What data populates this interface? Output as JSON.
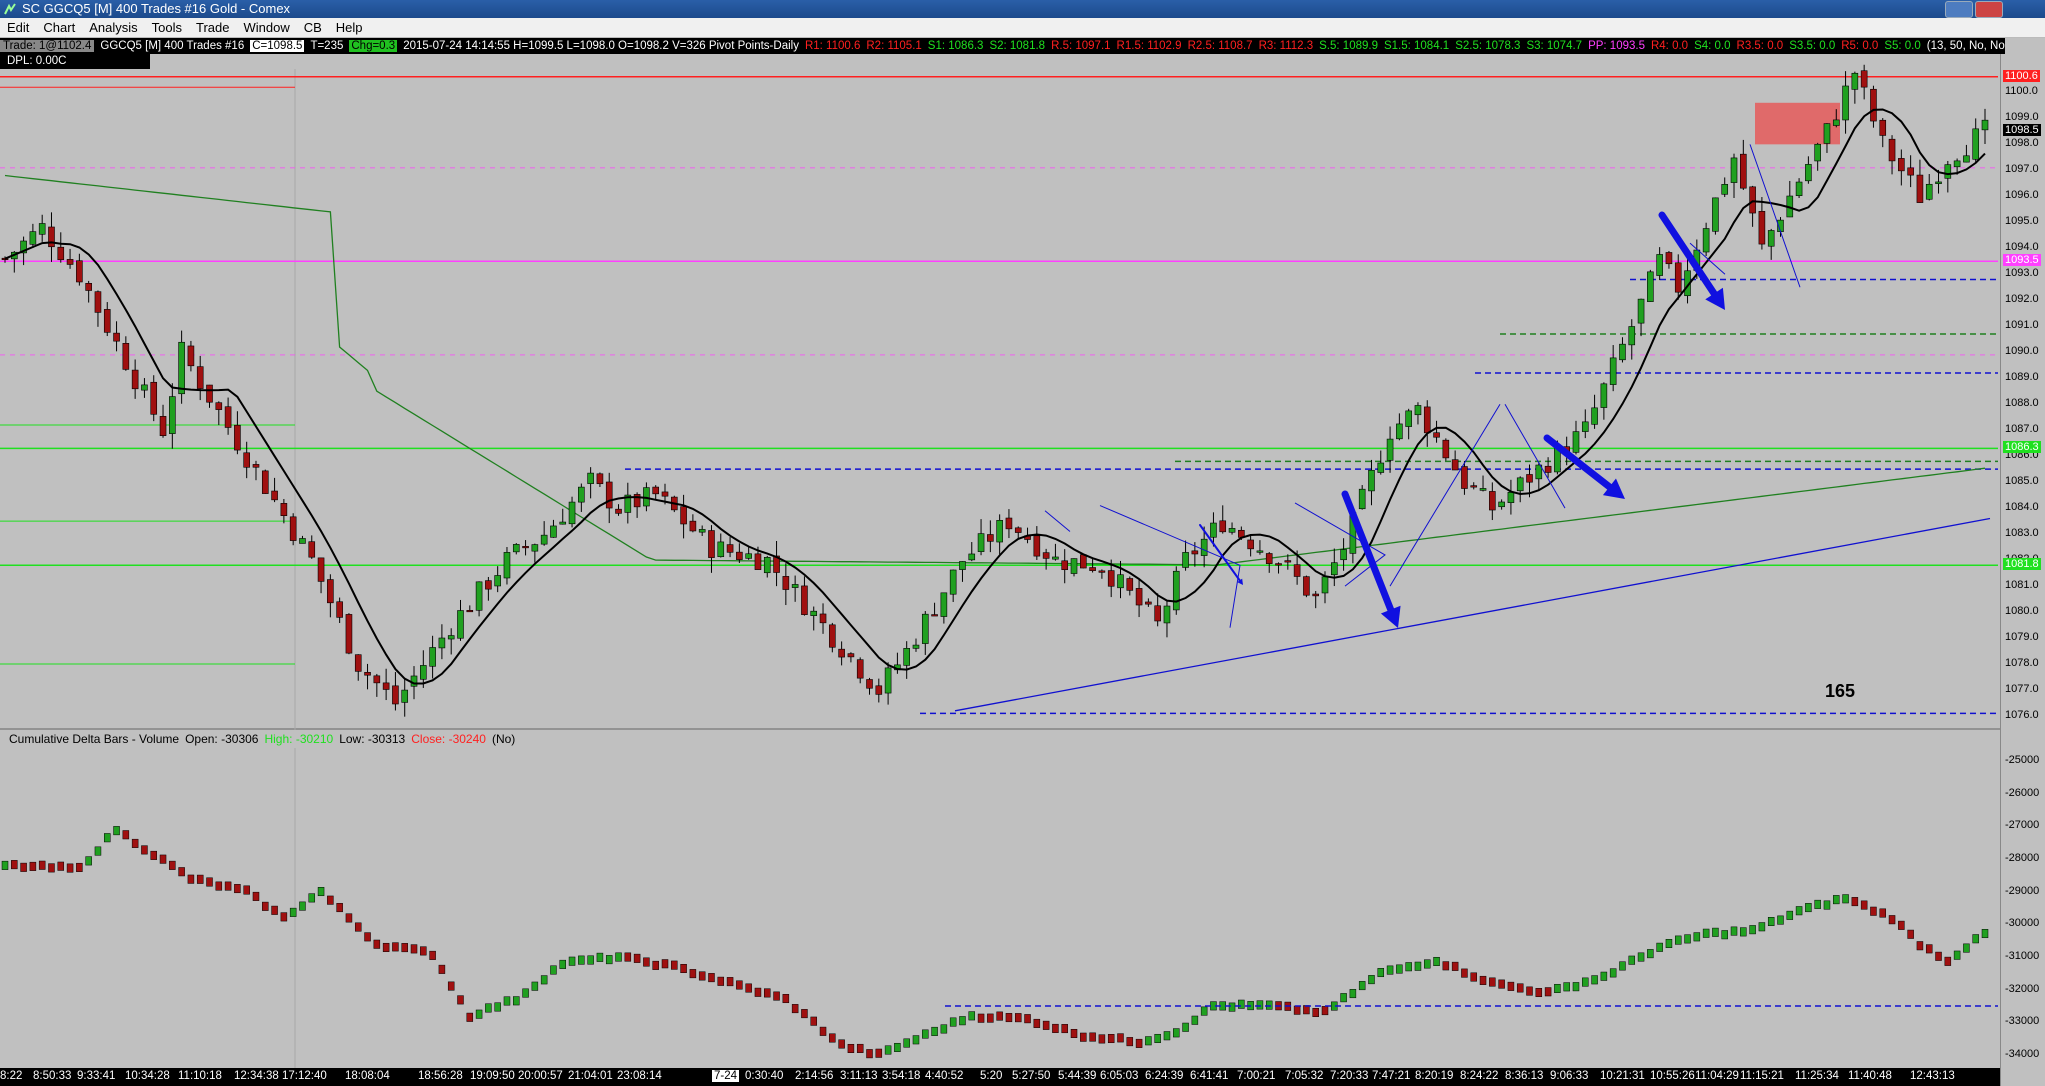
{
  "window": {
    "title": "SC GGCQ5 [M]  400 Trades  #16  Gold - Comex"
  },
  "menu": [
    "Edit",
    "Chart",
    "Analysis",
    "Tools",
    "Trade",
    "Window",
    "CB",
    "Help"
  ],
  "info": {
    "trade": "Trade: 1@1102.4",
    "symbol": "GGCQ5 [M]  400 Trades  #16",
    "last": "C=1098.5",
    "tick": "T=235",
    "chg": "Chg=0.3",
    "ohlc": "2015-07-24 14:14:55 H=1099.5 L=1098.0 O=1098.2 V=326 Pivot Points-Daily",
    "pivots": [
      {
        "t": "R1: 1100.6",
        "c": "#ff2020"
      },
      {
        "t": "R2: 1105.1",
        "c": "#ff2020"
      },
      {
        "t": "S1: 1086.3",
        "c": "#20e020"
      },
      {
        "t": "S2: 1081.8",
        "c": "#20e020"
      },
      {
        "t": "R.5: 1097.1",
        "c": "#ff2020"
      },
      {
        "t": "R1.5: 1102.9",
        "c": "#ff2020"
      },
      {
        "t": "R2.5: 1108.7",
        "c": "#ff2020"
      },
      {
        "t": "R3: 1112.3",
        "c": "#ff2020"
      },
      {
        "t": "S.5: 1089.9",
        "c": "#20e020"
      },
      {
        "t": "S1.5: 1084.1",
        "c": "#20e020"
      },
      {
        "t": "S2.5: 1078.3",
        "c": "#20e020"
      },
      {
        "t": "S3: 1074.7",
        "c": "#20e020"
      },
      {
        "t": "PP: 1093.5",
        "c": "#ff40ff"
      },
      {
        "t": "R4: 0.0",
        "c": "#ff2020"
      },
      {
        "t": "S4: 0.0",
        "c": "#20e020"
      },
      {
        "t": "R3.5: 0.0",
        "c": "#ff2020"
      },
      {
        "t": "S3.5: 0.0",
        "c": "#20e020"
      },
      {
        "t": "R5: 0.0",
        "c": "#ff2020"
      },
      {
        "t": "S5: 0.0",
        "c": "#20e020"
      },
      {
        "t": "(13, 50, No, No, #1, No, No, No,",
        "c": "#ffffff"
      }
    ],
    "dpl": "DPL: 0.00C"
  },
  "pane2": {
    "name": "Cumulative Delta Bars - Volume",
    "open": "Open: -30306",
    "high": "High: -30210",
    "low": "Low: -30313",
    "close": "Close: -30240",
    "extra": "(No)"
  },
  "annotation": "165",
  "price_axis": [
    "1100.0",
    "1099.0",
    "1098.0",
    "1097.0",
    "1096.0",
    "1095.0",
    "1094.0",
    "1093.0",
    "1092.0",
    "1091.0",
    "1090.0",
    "1089.0",
    "1088.0",
    "1087.0",
    "1086.0",
    "1085.0",
    "1084.0",
    "1083.0",
    "1082.0",
    "1081.0",
    "1080.0",
    "1079.0",
    "1078.0",
    "1077.0",
    "1076.0"
  ],
  "price_tags": [
    {
      "t": "1100.6",
      "bg": "#ff2020",
      "fg": "#ffffff",
      "v": 1100.6
    },
    {
      "t": "1098.5",
      "bg": "#000000",
      "fg": "#ffffff",
      "v": 1098.5
    },
    {
      "t": "1093.5",
      "bg": "#ff40ff",
      "fg": "#ffffff",
      "v": 1093.5
    },
    {
      "t": "1086.3",
      "bg": "#20e020",
      "fg": "#ffffff",
      "v": 1086.3
    },
    {
      "t": "1081.8",
      "bg": "#20e020",
      "fg": "#ffffff",
      "v": 1081.8
    }
  ],
  "delta_axis": [
    "-25000",
    "-26000",
    "-27000",
    "-28000",
    "-29000",
    "-30000",
    "-31000",
    "-32000",
    "-33000",
    "-34000"
  ],
  "time_axis": [
    "8:22",
    "8:50:33",
    "9:33:41",
    "10:34:28",
    "11:10:18",
    "12:34:38",
    "17:12:40",
    "18:08:04",
    "18:56:28",
    "19:09:50",
    "20:00:57",
    "21:04:01",
    "23:08:14",
    "7-24",
    "0:30:40",
    "2:14:56",
    "3:11:13",
    "3:54:18",
    "4:40:52",
    "5:20",
    "5:27:50",
    "5:44:39",
    "6:05:03",
    "6:24:39",
    "6:41:41",
    "7:00:21",
    "7:05:32",
    "7:20:33",
    "7:47:21",
    "8:20:19",
    "8:24:22",
    "8:36:13",
    "9:06:33",
    "10:21:31",
    "10:55:26",
    "11:04:29",
    "11:15:21",
    "11:25:34",
    "11:40:48",
    "12:43:13"
  ],
  "colors": {
    "up": "#20a020",
    "down": "#a01010",
    "ma": "#000000",
    "ma_long": "#208020",
    "pivot_pp": "#ff40ff",
    "resistance": "#ff2020",
    "support": "#20e020",
    "blue_level": "#1010d0",
    "arrow": "#1010e0"
  },
  "chart_data": [
    {
      "type": "candlestick",
      "title": "GGCQ5 [M] 400 Trades #16 Gold - Comex",
      "ylim": [
        1075.5,
        1100.9
      ],
      "y_anchor_points": [
        {
          "t": 0,
          "price": 1093.6
        },
        {
          "t": 4,
          "price": 1094.8
        },
        {
          "t": 8,
          "price": 1093.0
        },
        {
          "t": 14,
          "price": 1089.0
        },
        {
          "t": 17,
          "price": 1087.0
        },
        {
          "t": 19,
          "price": 1090.0
        },
        {
          "t": 26,
          "price": 1086.0
        },
        {
          "t": 33,
          "price": 1082.0
        },
        {
          "t": 38,
          "price": 1078.0
        },
        {
          "t": 42,
          "price": 1076.5
        },
        {
          "t": 48,
          "price": 1079.5
        },
        {
          "t": 54,
          "price": 1082.0
        },
        {
          "t": 58,
          "price": 1083.0
        },
        {
          "t": 63,
          "price": 1085.0
        },
        {
          "t": 66,
          "price": 1084.0
        },
        {
          "t": 70,
          "price": 1084.5
        },
        {
          "t": 76,
          "price": 1082.5
        },
        {
          "t": 82,
          "price": 1082.0
        },
        {
          "t": 88,
          "price": 1079.5
        },
        {
          "t": 94,
          "price": 1077.0
        },
        {
          "t": 97,
          "price": 1078.5
        },
        {
          "t": 103,
          "price": 1082.0
        },
        {
          "t": 108,
          "price": 1083.5
        },
        {
          "t": 113,
          "price": 1082.0
        },
        {
          "t": 118,
          "price": 1081.8
        },
        {
          "t": 124,
          "price": 1079.5
        },
        {
          "t": 127,
          "price": 1082.0
        },
        {
          "t": 131,
          "price": 1083.5
        },
        {
          "t": 137,
          "price": 1082.0
        },
        {
          "t": 141,
          "price": 1080.5
        },
        {
          "t": 144,
          "price": 1082.5
        },
        {
          "t": 149,
          "price": 1087.0
        },
        {
          "t": 152,
          "price": 1087.8
        },
        {
          "t": 157,
          "price": 1085.0
        },
        {
          "t": 160,
          "price": 1084.0
        },
        {
          "t": 165,
          "price": 1085.5
        },
        {
          "t": 170,
          "price": 1087.0
        },
        {
          "t": 175,
          "price": 1091.0
        },
        {
          "t": 178,
          "price": 1093.5
        },
        {
          "t": 180,
          "price": 1092.5
        },
        {
          "t": 183,
          "price": 1095.0
        },
        {
          "t": 186,
          "price": 1097.5
        },
        {
          "t": 189,
          "price": 1094.0
        },
        {
          "t": 192,
          "price": 1096.0
        },
        {
          "t": 196,
          "price": 1098.5
        },
        {
          "t": 199,
          "price": 1100.8
        },
        {
          "t": 202,
          "price": 1098.0
        },
        {
          "t": 206,
          "price": 1096.0
        },
        {
          "t": 209,
          "price": 1097.5
        },
        {
          "t": 213,
          "price": 1098.5
        }
      ],
      "levels": [
        {
          "name": "R1",
          "price": 1100.6,
          "color": "#ff2020",
          "style": "solid"
        },
        {
          "name": "PP",
          "price": 1093.5,
          "color": "#ff40ff",
          "style": "solid"
        },
        {
          "name": "R.5",
          "price": 1097.1,
          "color": "#ff40ff",
          "style": "dashed-faint"
        },
        {
          "name": "S.5",
          "price": 1089.9,
          "color": "#ff40ff",
          "style": "dashed-faint"
        },
        {
          "name": "S1",
          "price": 1086.3,
          "color": "#20e020",
          "style": "solid"
        },
        {
          "name": "S2",
          "price": 1081.8,
          "color": "#20e020",
          "style": "solid"
        },
        {
          "name": "blue1",
          "price": 1092.8,
          "color": "#1010d0",
          "style": "dashed"
        },
        {
          "name": "green1",
          "price": 1090.7,
          "color": "#208020",
          "style": "dashed"
        },
        {
          "name": "blue2",
          "price": 1089.2,
          "color": "#1010d0",
          "style": "dashed"
        },
        {
          "name": "green2",
          "price": 1085.8,
          "color": "#208020",
          "style": "dashed"
        },
        {
          "name": "blue3",
          "price": 1085.5,
          "color": "#1010d0",
          "style": "dashed"
        },
        {
          "name": "blue4",
          "price": 1076.1,
          "color": "#1010d0",
          "style": "dashed"
        }
      ],
      "supply_zone": {
        "price_low": 1098.0,
        "price_high": 1099.6
      }
    },
    {
      "type": "bar",
      "title": "Cumulative Delta Bars - Volume",
      "ylim": [
        -34400,
        -24600
      ],
      "anchor_points": [
        {
          "t": 0,
          "v": -28200
        },
        {
          "t": 8,
          "v": -28300
        },
        {
          "t": 12,
          "v": -27100
        },
        {
          "t": 20,
          "v": -28600
        },
        {
          "t": 26,
          "v": -29000
        },
        {
          "t": 30,
          "v": -29800
        },
        {
          "t": 34,
          "v": -29000
        },
        {
          "t": 40,
          "v": -30600
        },
        {
          "t": 46,
          "v": -30900
        },
        {
          "t": 50,
          "v": -32800
        },
        {
          "t": 55,
          "v": -32300
        },
        {
          "t": 60,
          "v": -31200
        },
        {
          "t": 66,
          "v": -31000
        },
        {
          "t": 72,
          "v": -31300
        },
        {
          "t": 78,
          "v": -31800
        },
        {
          "t": 84,
          "v": -32300
        },
        {
          "t": 90,
          "v": -33700
        },
        {
          "t": 94,
          "v": -34000
        },
        {
          "t": 104,
          "v": -32800
        },
        {
          "t": 110,
          "v": -32900
        },
        {
          "t": 116,
          "v": -33400
        },
        {
          "t": 122,
          "v": -33600
        },
        {
          "t": 126,
          "v": -33300
        },
        {
          "t": 130,
          "v": -32500
        },
        {
          "t": 136,
          "v": -32500
        },
        {
          "t": 142,
          "v": -32700
        },
        {
          "t": 148,
          "v": -31500
        },
        {
          "t": 154,
          "v": -31100
        },
        {
          "t": 160,
          "v": -31800
        },
        {
          "t": 166,
          "v": -32100
        },
        {
          "t": 172,
          "v": -31600
        },
        {
          "t": 178,
          "v": -30700
        },
        {
          "t": 183,
          "v": -30300
        },
        {
          "t": 188,
          "v": -30200
        },
        {
          "t": 193,
          "v": -29600
        },
        {
          "t": 198,
          "v": -29200
        },
        {
          "t": 203,
          "v": -29800
        },
        {
          "t": 206,
          "v": -30600
        },
        {
          "t": 209,
          "v": -31100
        },
        {
          "t": 213,
          "v": -30300
        }
      ],
      "levels": [
        {
          "name": "blue",
          "v": -32500,
          "color": "#1010d0",
          "style": "dashed"
        }
      ]
    }
  ]
}
